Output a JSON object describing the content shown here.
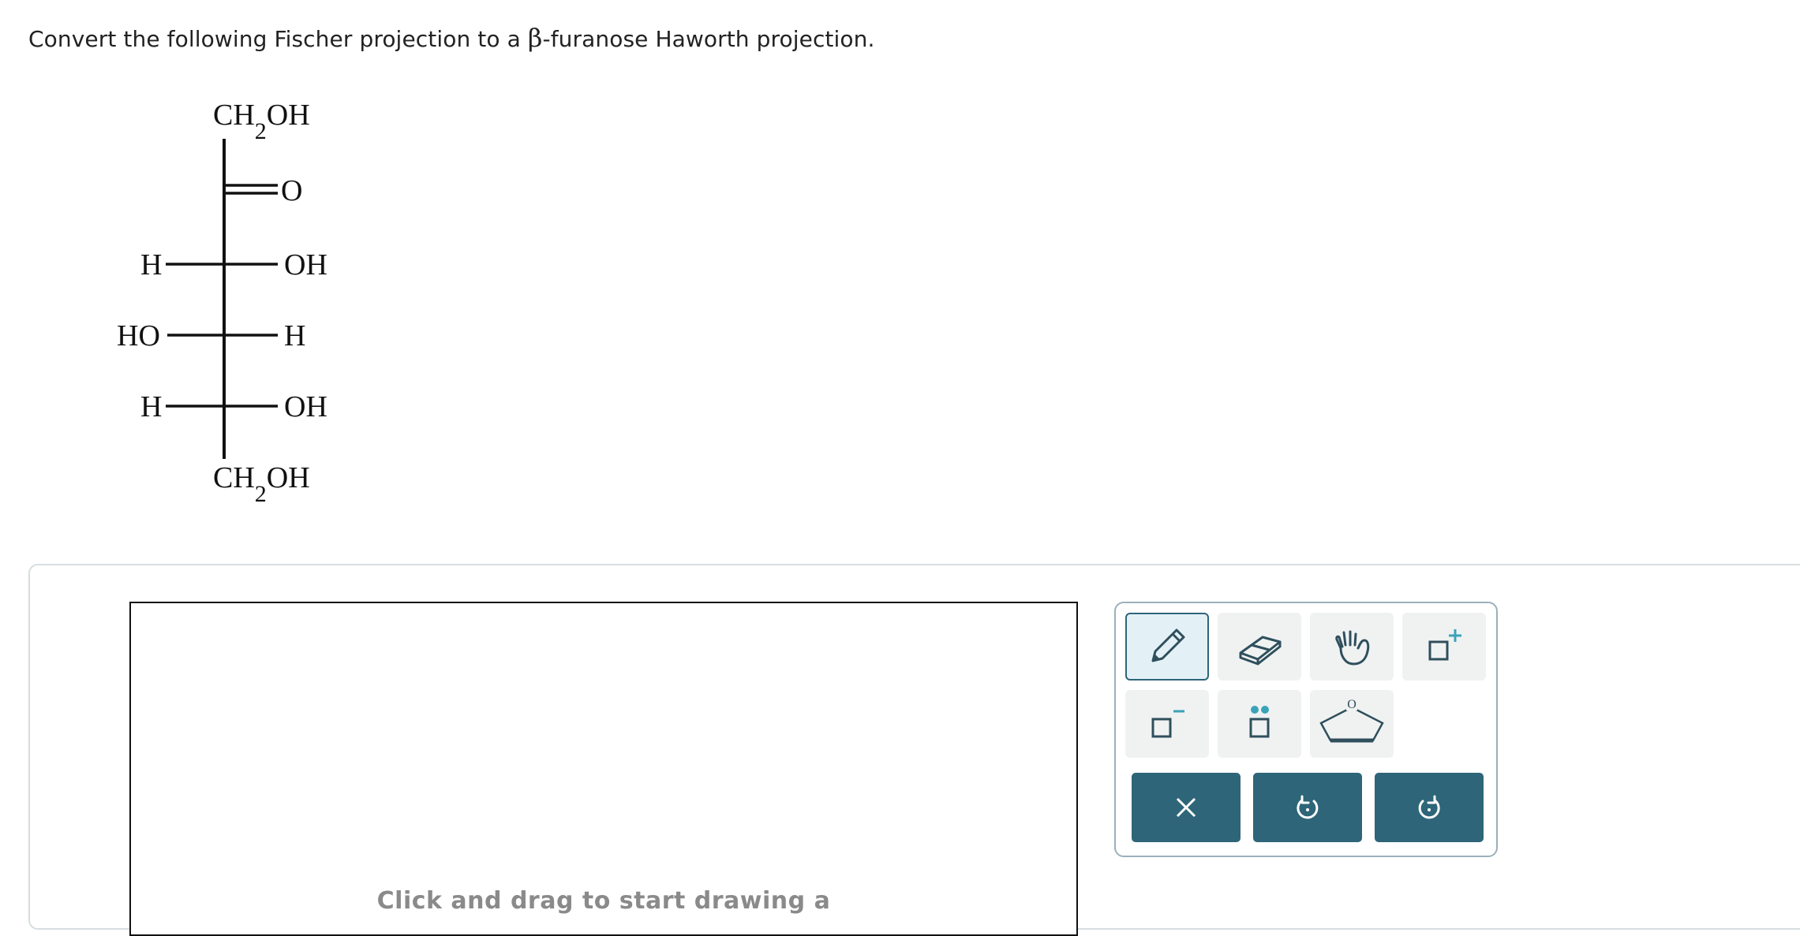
{
  "question": {
    "prefix": "Convert the following Fischer projection to a ",
    "greek": "β",
    "suffix": "-furanose Haworth projection."
  },
  "fischer": {
    "top_group": "CH₂OH",
    "carbonyl_o": "O",
    "rows": [
      {
        "left": "H",
        "right": "OH"
      },
      {
        "left": "HO",
        "right": "H"
      },
      {
        "left": "H",
        "right": "OH"
      }
    ],
    "bottom_group": "CH₂OH"
  },
  "canvas": {
    "hint": "Click and drag to start drawing a"
  },
  "toolbar": {
    "tools": [
      {
        "name": "pencil-tool",
        "icon": "pencil-icon",
        "active": true
      },
      {
        "name": "eraser-tool",
        "icon": "eraser-icon",
        "active": false
      },
      {
        "name": "hand-tool",
        "icon": "hand-icon",
        "active": false
      },
      {
        "name": "positive-charge-tool",
        "icon": "square-plus-icon",
        "active": false
      },
      {
        "name": "negative-charge-tool",
        "icon": "square-minus-icon",
        "active": false
      },
      {
        "name": "lone-pair-tool",
        "icon": "lone-pair-icon",
        "active": false
      },
      {
        "name": "furanose-ring-tool",
        "icon": "pentagon-ring-icon",
        "active": false
      }
    ],
    "ring_label": "O",
    "actions": [
      {
        "name": "clear-button",
        "icon": "close-icon"
      },
      {
        "name": "undo-button",
        "icon": "undo-icon"
      },
      {
        "name": "redo-button",
        "icon": "redo-icon"
      }
    ]
  },
  "colors": {
    "accent": "#2e6579",
    "accent_light": "#3aa3b8",
    "tool_bg": "#f0f2f2"
  }
}
